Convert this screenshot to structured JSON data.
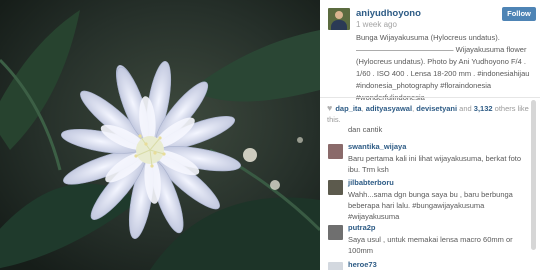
{
  "post": {
    "username": "aniyudhoyono",
    "time": "1 week ago",
    "follow_label": "Follow",
    "caption": "Bunga Wijayakusuma (Hylocreus undatus).\n————————————— Wijayakusuma flower (Hylocreus undatus). Photo by Ani Yudhoyono F/4 . 1/60 . ISO 400 . Lensa 18-200 mm . #indonesiahijau #indonesia_photography #florаindonesia #wonderfulindonesia"
  },
  "likes": {
    "users": [
      "dap_ita",
      "adityasyawal",
      "devisetyani"
    ],
    "separator1": ", ",
    "separator2": ", ",
    "and_text": " and ",
    "count": "3,132",
    "suffix": " others like this."
  },
  "comments": {
    "fragment": "dan cantik",
    "items": [
      {
        "user": "swantika_wijaya",
        "text": "Baru pertama kali ini lihat wijayakusuma, berkat foto ibu. Trm ksh"
      },
      {
        "user": "jilbabterboru",
        "text": "Wahh...sama dgn bunga saya bu , baru berbunga beberapa hari lalu. #bungawijayakusuma #wijayakusuma"
      },
      {
        "user": "putra2p",
        "text": "Saya usul , untuk memakai lensa macro 60mm or 100mm"
      },
      {
        "user": "heroe73",
        "text": ""
      }
    ]
  },
  "colors": {
    "link": "#2d5b85",
    "follow_bg": "#4e84b5",
    "photo_bg": "#1f2b24"
  }
}
